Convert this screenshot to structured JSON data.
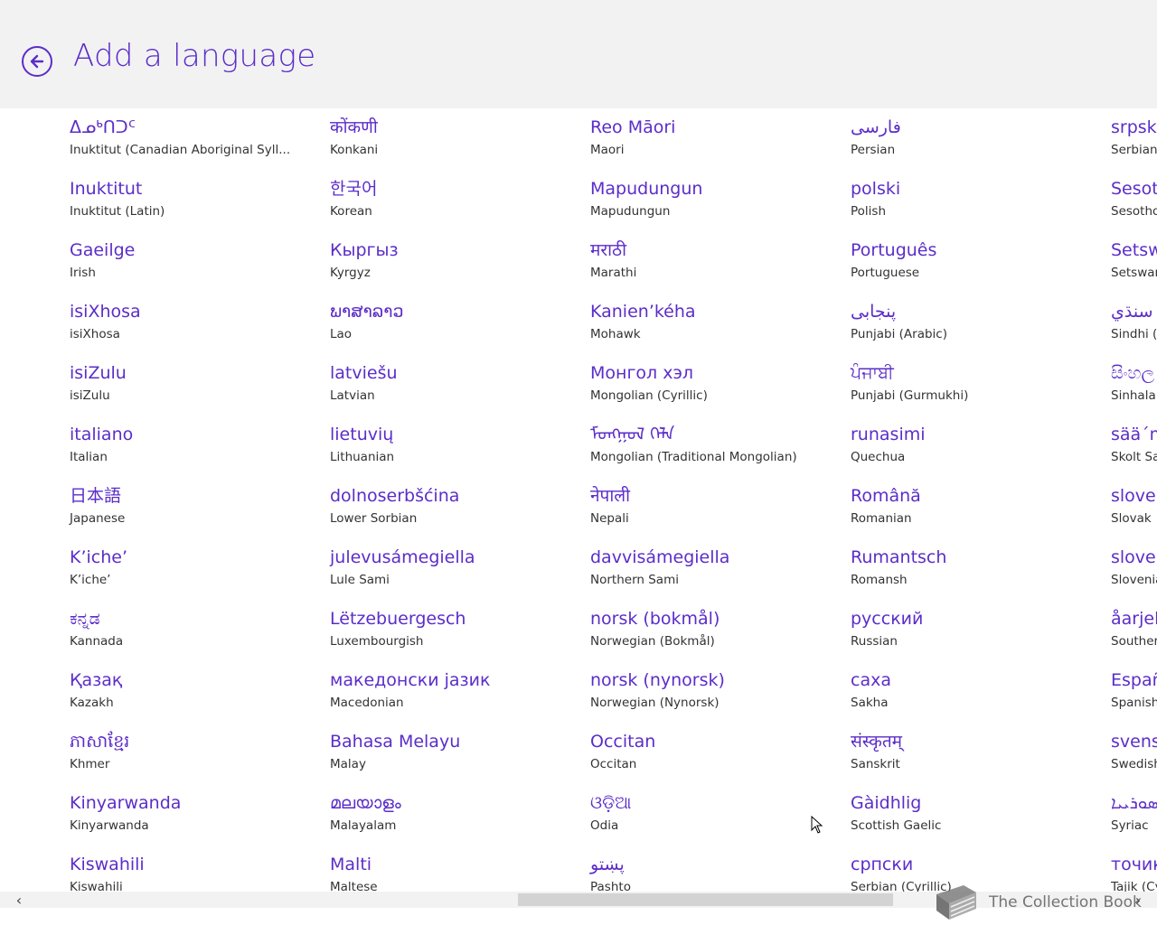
{
  "header": {
    "title": "Add a language"
  },
  "columns": [
    {
      "items": [
        {
          "native": "ᐃᓄᒃᑎᑐᑦ",
          "english": "Inuktitut (Canadian Aboriginal Syll..."
        },
        {
          "native": "Inuktitut",
          "english": "Inuktitut (Latin)"
        },
        {
          "native": "Gaeilge",
          "english": "Irish"
        },
        {
          "native": "isiXhosa",
          "english": "isiXhosa"
        },
        {
          "native": "isiZulu",
          "english": "isiZulu"
        },
        {
          "native": "italiano",
          "english": "Italian"
        },
        {
          "native": "日本語",
          "english": "Japanese"
        },
        {
          "native": "K’iche’",
          "english": "K’iche’"
        },
        {
          "native": "ಕನ್ನಡ",
          "english": "Kannada"
        },
        {
          "native": "Қазақ",
          "english": "Kazakh"
        },
        {
          "native": "ភាសាខ្មែរ",
          "english": "Khmer"
        },
        {
          "native": "Kinyarwanda",
          "english": "Kinyarwanda"
        },
        {
          "native": "Kiswahili",
          "english": "Kiswahili"
        }
      ]
    },
    {
      "items": [
        {
          "native": "कोंकणी",
          "english": "Konkani"
        },
        {
          "native": "한국어",
          "english": "Korean"
        },
        {
          "native": "Кыргыз",
          "english": "Kyrgyz"
        },
        {
          "native": "ພາສາລາວ",
          "english": "Lao"
        },
        {
          "native": "latviešu",
          "english": "Latvian"
        },
        {
          "native": "lietuvių",
          "english": "Lithuanian"
        },
        {
          "native": "dolnoserbšćina",
          "english": "Lower Sorbian"
        },
        {
          "native": "julevusámegiella",
          "english": "Lule Sami"
        },
        {
          "native": "Lëtzebuergesch",
          "english": "Luxembourgish"
        },
        {
          "native": "македонски јазик",
          "english": "Macedonian"
        },
        {
          "native": "Bahasa Melayu",
          "english": "Malay"
        },
        {
          "native": "മലയാളം",
          "english": "Malayalam"
        },
        {
          "native": "Malti",
          "english": "Maltese"
        }
      ]
    },
    {
      "items": [
        {
          "native": "Reo Māori",
          "english": "Maori"
        },
        {
          "native": "Mapudungun",
          "english": "Mapudungun"
        },
        {
          "native": "मराठी",
          "english": "Marathi"
        },
        {
          "native": "Kanien’kéha",
          "english": "Mohawk"
        },
        {
          "native": "Монгол хэл",
          "english": "Mongolian (Cyrillic)"
        },
        {
          "native": "ᠮᠣᠩᠭᠣᠯ ᠬᠡᠯᠡ",
          "english": "Mongolian (Traditional Mongolian)"
        },
        {
          "native": "नेपाली",
          "english": "Nepali"
        },
        {
          "native": "davvisámegiella",
          "english": "Northern Sami"
        },
        {
          "native": "norsk (bokmål)",
          "english": "Norwegian (Bokmål)"
        },
        {
          "native": "norsk (nynorsk)",
          "english": "Norwegian (Nynorsk)"
        },
        {
          "native": "Occitan",
          "english": "Occitan"
        },
        {
          "native": "ଓଡ଼ିଆ",
          "english": "Odia"
        },
        {
          "native": "پښتو",
          "english": "Pashto"
        }
      ]
    },
    {
      "items": [
        {
          "native": "فارسی",
          "english": "Persian"
        },
        {
          "native": "polski",
          "english": "Polish"
        },
        {
          "native": "Português",
          "english": "Portuguese"
        },
        {
          "native": "پنجابی",
          "english": "Punjabi (Arabic)"
        },
        {
          "native": "ਪੰਜਾਬੀ",
          "english": "Punjabi (Gurmukhi)"
        },
        {
          "native": "runasimi",
          "english": "Quechua"
        },
        {
          "native": "Română",
          "english": "Romanian"
        },
        {
          "native": "Rumantsch",
          "english": "Romansh"
        },
        {
          "native": "русский",
          "english": "Russian"
        },
        {
          "native": "саха",
          "english": "Sakha"
        },
        {
          "native": "संस्कृतम्",
          "english": "Sanskrit"
        },
        {
          "native": "Gàidhlig",
          "english": "Scottish Gaelic"
        },
        {
          "native": "српски",
          "english": "Serbian (Cyrillic)"
        }
      ]
    },
    {
      "items": [
        {
          "native": "srpski",
          "english": "Serbian"
        },
        {
          "native": "Sesot",
          "english": "Sesotho"
        },
        {
          "native": "Setsw",
          "english": "Setswan"
        },
        {
          "native": "سنڌي",
          "english": "Sindhi (A"
        },
        {
          "native": "සිංහල",
          "english": "Sinhala"
        },
        {
          "native": "sää´m",
          "english": "Skolt Sa"
        },
        {
          "native": "sloven",
          "english": "Slovak"
        },
        {
          "native": "sloven",
          "english": "Slovenia"
        },
        {
          "native": "åarjel",
          "english": "Souther"
        },
        {
          "native": "Españ",
          "english": "Spanish"
        },
        {
          "native": "svens",
          "english": "Swedish"
        },
        {
          "native": "ܣܘܪܝܝܐ",
          "english": "Syriac"
        },
        {
          "native": "точик",
          "english": "Tajik (Cy"
        }
      ]
    }
  ],
  "watermark": {
    "text": "The Collection Book"
  },
  "colors": {
    "accent": "#5b2dc9",
    "header_bg": "#f2f2f2"
  }
}
